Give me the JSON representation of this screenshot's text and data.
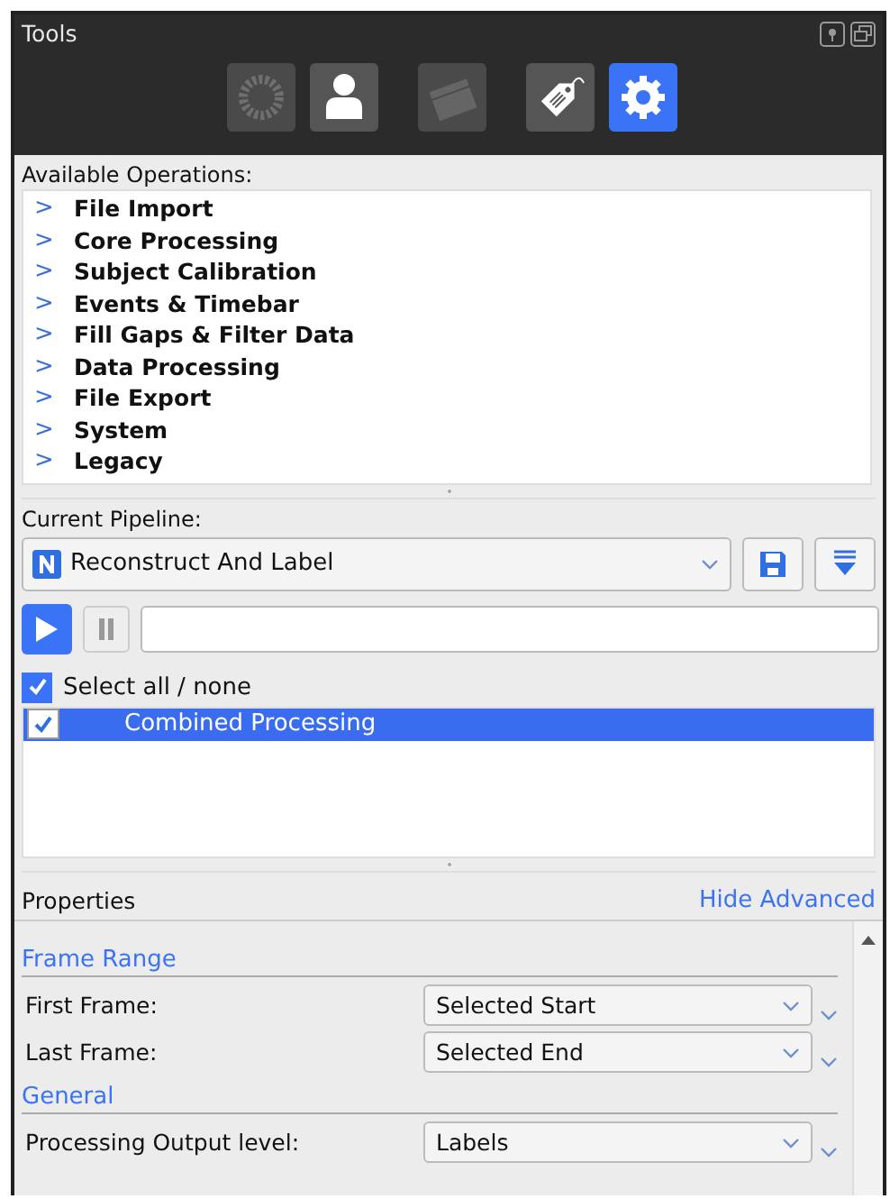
{
  "window": {
    "title": "Tools"
  },
  "tools": [
    {
      "kind": "markers",
      "selected": false,
      "disabled": true
    },
    {
      "kind": "subject",
      "selected": false,
      "disabled": false
    },
    {
      "kind": "clapper",
      "selected": false,
      "disabled": true
    },
    {
      "kind": "tag",
      "selected": false,
      "disabled": false
    },
    {
      "kind": "gear",
      "selected": true,
      "disabled": false
    }
  ],
  "operations": {
    "label": "Available Operations:",
    "items": [
      {
        "arrow": ">",
        "label": "File Import"
      },
      {
        "arrow": ">",
        "label": "Core Processing"
      },
      {
        "arrow": ">",
        "label": "Subject Calibration"
      },
      {
        "arrow": ">",
        "label": "Events & Timebar"
      },
      {
        "arrow": ">",
        "label": "Fill Gaps & Filter Data"
      },
      {
        "arrow": ">",
        "label": "Data Processing"
      },
      {
        "arrow": ">",
        "label": "File Export"
      },
      {
        "arrow": ">",
        "label": "System"
      },
      {
        "arrow": ">",
        "label": "Legacy"
      }
    ]
  },
  "pipeline": {
    "label": "Current Pipeline:",
    "value": "Reconstruct And Label",
    "select_all": {
      "label": "Select all / none",
      "checked": true
    },
    "items": [
      {
        "label": "Combined Processing",
        "checked": true,
        "selected": true
      }
    ]
  },
  "properties": {
    "title": "Properties",
    "link": "Hide Advanced",
    "sections": [
      {
        "title": "Frame Range",
        "rows": [
          {
            "label": "First Frame:",
            "value": "Selected Start"
          },
          {
            "label": "Last Frame:",
            "value": "Selected End"
          }
        ]
      },
      {
        "title": "General",
        "rows": [
          {
            "label": "Processing Output level:",
            "value": "Labels"
          }
        ]
      }
    ]
  }
}
